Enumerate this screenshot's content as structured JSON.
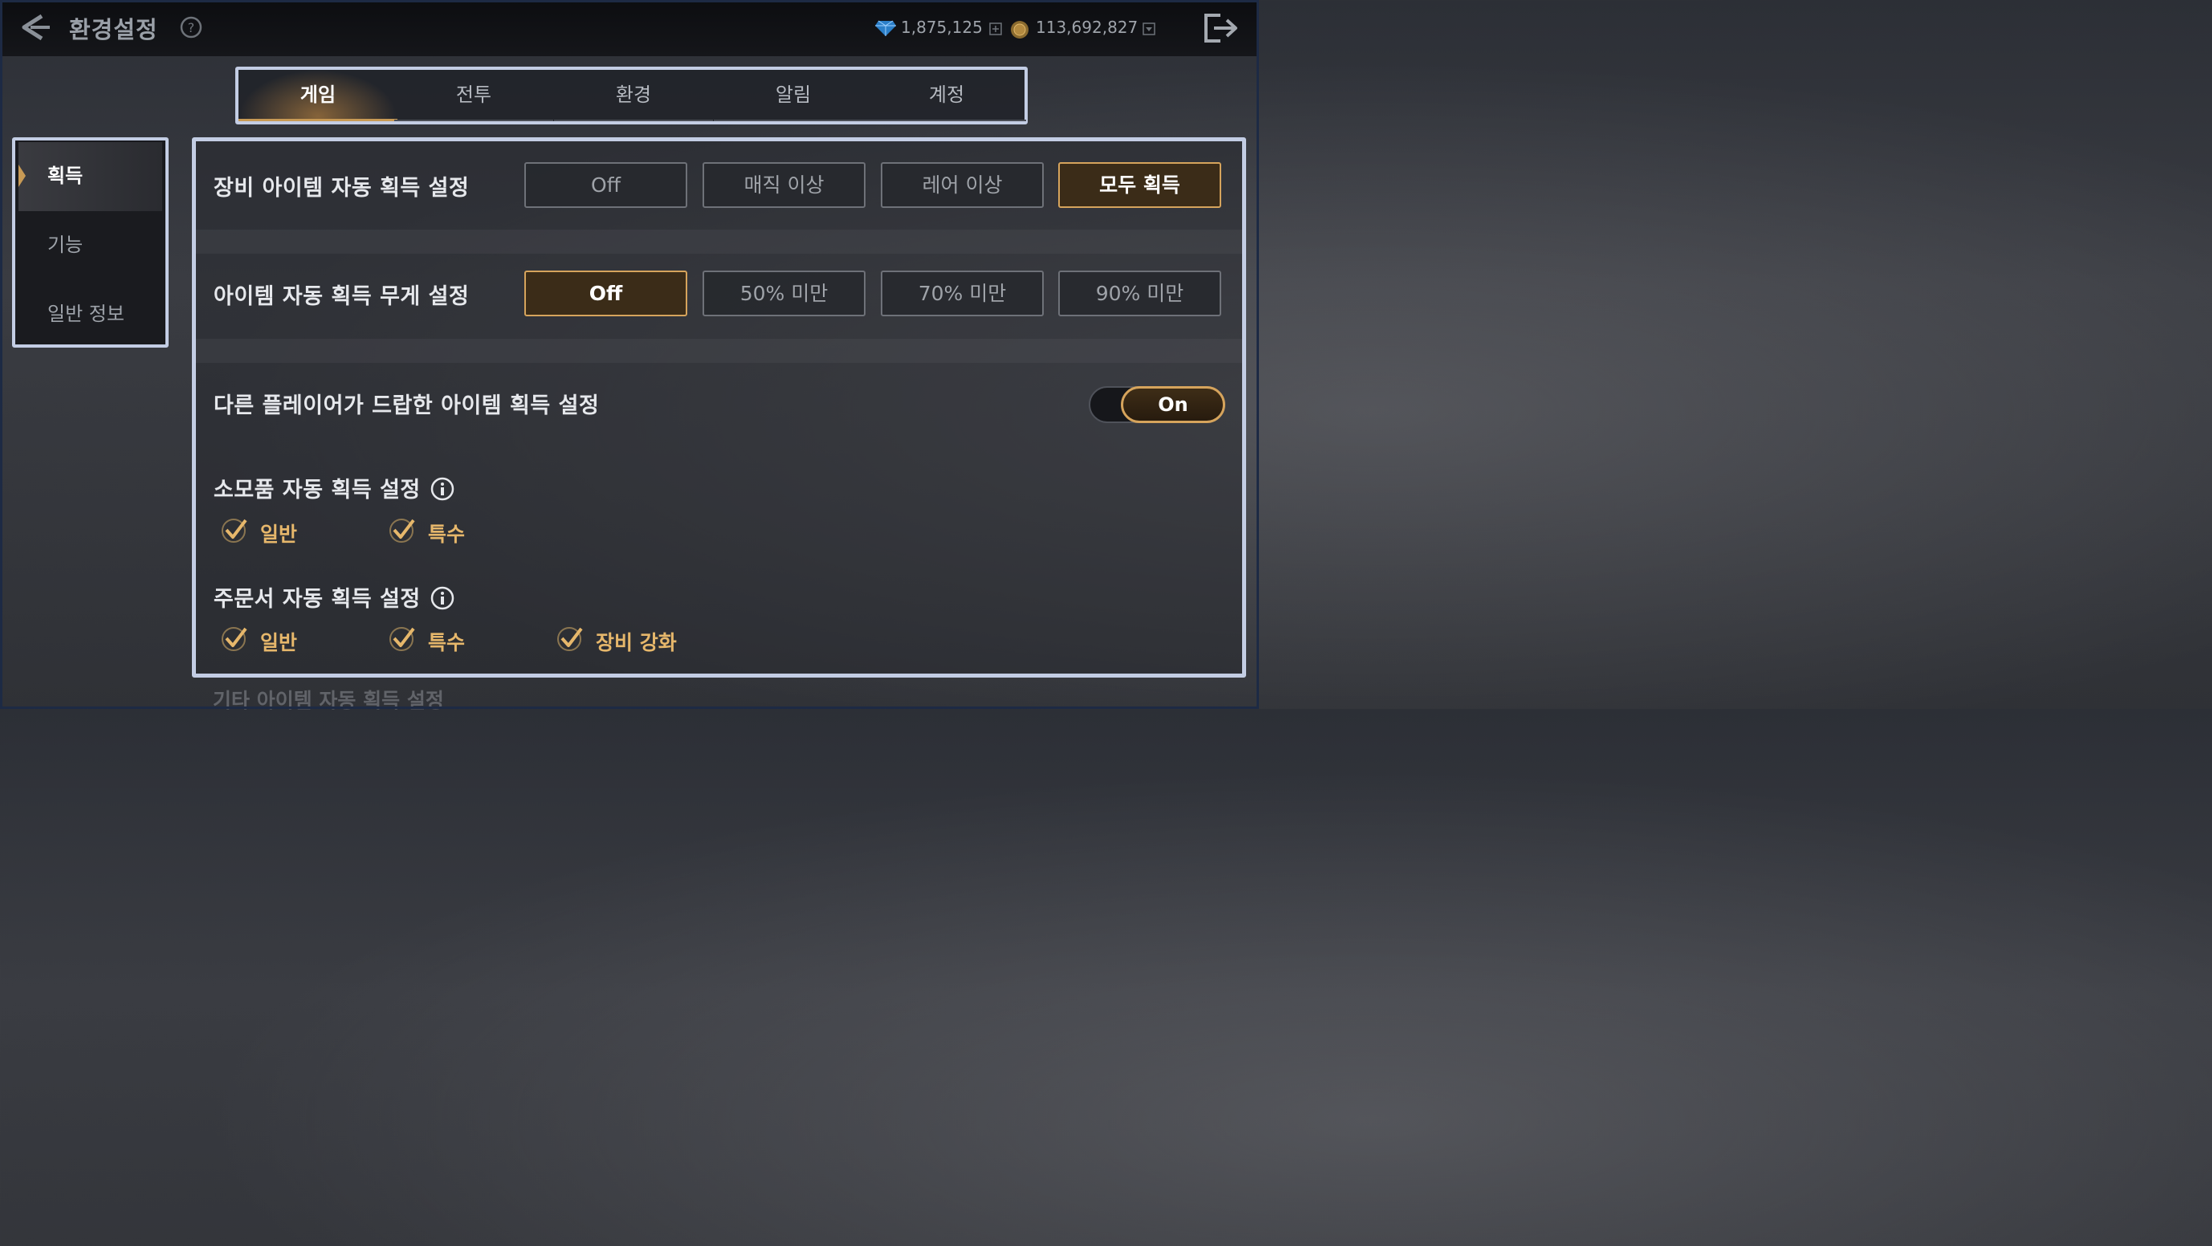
{
  "header": {
    "title": "환경설정",
    "gems": "1,875,125",
    "coins": "113,692,827"
  },
  "tabs": [
    "게임",
    "전투",
    "환경",
    "알림",
    "계정"
  ],
  "active_tab": "게임",
  "sidebar": {
    "items": [
      "획득",
      "기능",
      "일반 정보"
    ],
    "active": "획득"
  },
  "settings": {
    "equipment": {
      "label": "장비 아이템 자동 획득 설정",
      "options": [
        "Off",
        "매직 이상",
        "레어 이상",
        "모두 획득"
      ],
      "selected": "모두 획득"
    },
    "weight": {
      "label": "아이템 자동 획득 무게 설정",
      "options": [
        "Off",
        "50% 미만",
        "70% 미만",
        "90% 미만"
      ],
      "selected": "Off"
    },
    "dropped": {
      "label": "다른 플레이어가 드랍한 아이템 획득 설정",
      "toggle": "On"
    },
    "consumable": {
      "label": "소모품 자동 획득 설정",
      "checks": [
        "일반",
        "특수"
      ]
    },
    "scroll": {
      "label": "주문서 자동 획득 설정",
      "checks": [
        "일반",
        "특수",
        "장비 강화"
      ]
    },
    "other": {
      "label": "기타 아이템 자동 획득 설정"
    }
  },
  "colors": {
    "accent": "#d6a45c",
    "highlight_frame": "#c3cde4"
  }
}
